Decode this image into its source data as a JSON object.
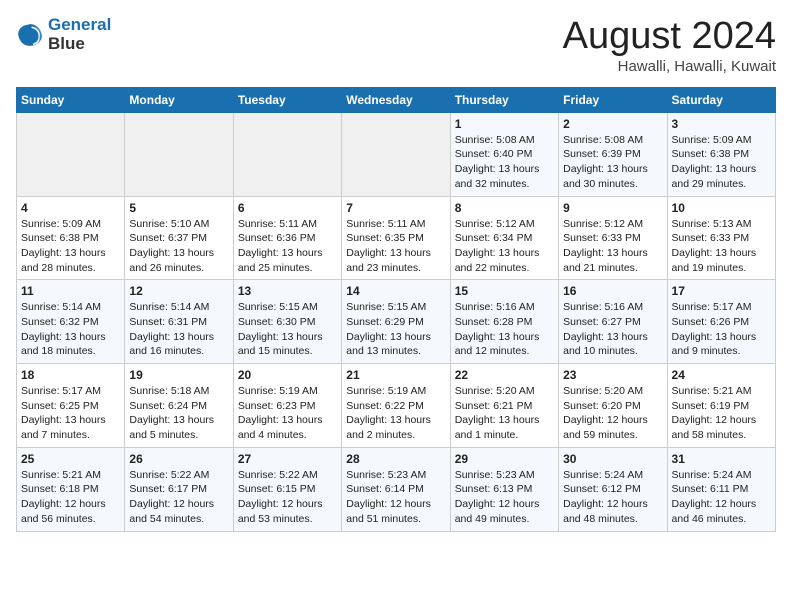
{
  "logo": {
    "line1": "General",
    "line2": "Blue"
  },
  "title": "August 2024",
  "subtitle": "Hawalli, Hawalli, Kuwait",
  "weekdays": [
    "Sunday",
    "Monday",
    "Tuesday",
    "Wednesday",
    "Thursday",
    "Friday",
    "Saturday"
  ],
  "weeks": [
    [
      {
        "day": "",
        "info": ""
      },
      {
        "day": "",
        "info": ""
      },
      {
        "day": "",
        "info": ""
      },
      {
        "day": "",
        "info": ""
      },
      {
        "day": "1",
        "info": "Sunrise: 5:08 AM\nSunset: 6:40 PM\nDaylight: 13 hours\nand 32 minutes."
      },
      {
        "day": "2",
        "info": "Sunrise: 5:08 AM\nSunset: 6:39 PM\nDaylight: 13 hours\nand 30 minutes."
      },
      {
        "day": "3",
        "info": "Sunrise: 5:09 AM\nSunset: 6:38 PM\nDaylight: 13 hours\nand 29 minutes."
      }
    ],
    [
      {
        "day": "4",
        "info": "Sunrise: 5:09 AM\nSunset: 6:38 PM\nDaylight: 13 hours\nand 28 minutes."
      },
      {
        "day": "5",
        "info": "Sunrise: 5:10 AM\nSunset: 6:37 PM\nDaylight: 13 hours\nand 26 minutes."
      },
      {
        "day": "6",
        "info": "Sunrise: 5:11 AM\nSunset: 6:36 PM\nDaylight: 13 hours\nand 25 minutes."
      },
      {
        "day": "7",
        "info": "Sunrise: 5:11 AM\nSunset: 6:35 PM\nDaylight: 13 hours\nand 23 minutes."
      },
      {
        "day": "8",
        "info": "Sunrise: 5:12 AM\nSunset: 6:34 PM\nDaylight: 13 hours\nand 22 minutes."
      },
      {
        "day": "9",
        "info": "Sunrise: 5:12 AM\nSunset: 6:33 PM\nDaylight: 13 hours\nand 21 minutes."
      },
      {
        "day": "10",
        "info": "Sunrise: 5:13 AM\nSunset: 6:33 PM\nDaylight: 13 hours\nand 19 minutes."
      }
    ],
    [
      {
        "day": "11",
        "info": "Sunrise: 5:14 AM\nSunset: 6:32 PM\nDaylight: 13 hours\nand 18 minutes."
      },
      {
        "day": "12",
        "info": "Sunrise: 5:14 AM\nSunset: 6:31 PM\nDaylight: 13 hours\nand 16 minutes."
      },
      {
        "day": "13",
        "info": "Sunrise: 5:15 AM\nSunset: 6:30 PM\nDaylight: 13 hours\nand 15 minutes."
      },
      {
        "day": "14",
        "info": "Sunrise: 5:15 AM\nSunset: 6:29 PM\nDaylight: 13 hours\nand 13 minutes."
      },
      {
        "day": "15",
        "info": "Sunrise: 5:16 AM\nSunset: 6:28 PM\nDaylight: 13 hours\nand 12 minutes."
      },
      {
        "day": "16",
        "info": "Sunrise: 5:16 AM\nSunset: 6:27 PM\nDaylight: 13 hours\nand 10 minutes."
      },
      {
        "day": "17",
        "info": "Sunrise: 5:17 AM\nSunset: 6:26 PM\nDaylight: 13 hours\nand 9 minutes."
      }
    ],
    [
      {
        "day": "18",
        "info": "Sunrise: 5:17 AM\nSunset: 6:25 PM\nDaylight: 13 hours\nand 7 minutes."
      },
      {
        "day": "19",
        "info": "Sunrise: 5:18 AM\nSunset: 6:24 PM\nDaylight: 13 hours\nand 5 minutes."
      },
      {
        "day": "20",
        "info": "Sunrise: 5:19 AM\nSunset: 6:23 PM\nDaylight: 13 hours\nand 4 minutes."
      },
      {
        "day": "21",
        "info": "Sunrise: 5:19 AM\nSunset: 6:22 PM\nDaylight: 13 hours\nand 2 minutes."
      },
      {
        "day": "22",
        "info": "Sunrise: 5:20 AM\nSunset: 6:21 PM\nDaylight: 13 hours\nand 1 minute."
      },
      {
        "day": "23",
        "info": "Sunrise: 5:20 AM\nSunset: 6:20 PM\nDaylight: 12 hours\nand 59 minutes."
      },
      {
        "day": "24",
        "info": "Sunrise: 5:21 AM\nSunset: 6:19 PM\nDaylight: 12 hours\nand 58 minutes."
      }
    ],
    [
      {
        "day": "25",
        "info": "Sunrise: 5:21 AM\nSunset: 6:18 PM\nDaylight: 12 hours\nand 56 minutes."
      },
      {
        "day": "26",
        "info": "Sunrise: 5:22 AM\nSunset: 6:17 PM\nDaylight: 12 hours\nand 54 minutes."
      },
      {
        "day": "27",
        "info": "Sunrise: 5:22 AM\nSunset: 6:15 PM\nDaylight: 12 hours\nand 53 minutes."
      },
      {
        "day": "28",
        "info": "Sunrise: 5:23 AM\nSunset: 6:14 PM\nDaylight: 12 hours\nand 51 minutes."
      },
      {
        "day": "29",
        "info": "Sunrise: 5:23 AM\nSunset: 6:13 PM\nDaylight: 12 hours\nand 49 minutes."
      },
      {
        "day": "30",
        "info": "Sunrise: 5:24 AM\nSunset: 6:12 PM\nDaylight: 12 hours\nand 48 minutes."
      },
      {
        "day": "31",
        "info": "Sunrise: 5:24 AM\nSunset: 6:11 PM\nDaylight: 12 hours\nand 46 minutes."
      }
    ]
  ]
}
